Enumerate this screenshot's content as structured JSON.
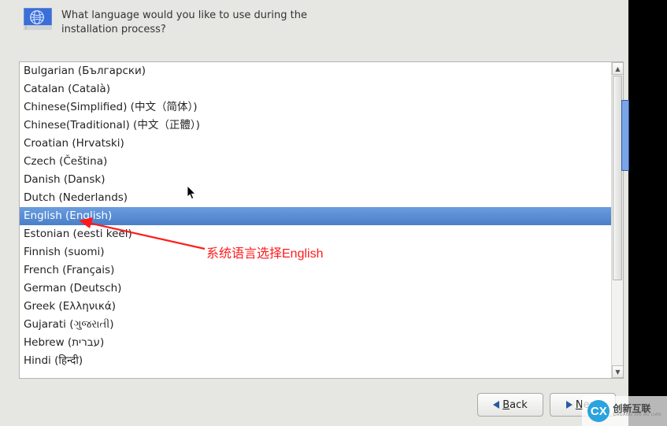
{
  "header": {
    "prompt_line1": "What language would you like to use during the",
    "prompt_line2": "installation process?"
  },
  "languages": [
    {
      "label": "Bulgarian (Български)",
      "selected": false
    },
    {
      "label": "Catalan (Català)",
      "selected": false
    },
    {
      "label": "Chinese(Simplified) (中文（简体）)",
      "selected": false
    },
    {
      "label": "Chinese(Traditional) (中文（正體）)",
      "selected": false
    },
    {
      "label": "Croatian (Hrvatski)",
      "selected": false
    },
    {
      "label": "Czech (Čeština)",
      "selected": false
    },
    {
      "label": "Danish (Dansk)",
      "selected": false
    },
    {
      "label": "Dutch (Nederlands)",
      "selected": false
    },
    {
      "label": "English (English)",
      "selected": true
    },
    {
      "label": "Estonian (eesti keel)",
      "selected": false
    },
    {
      "label": "Finnish (suomi)",
      "selected": false
    },
    {
      "label": "French (Français)",
      "selected": false
    },
    {
      "label": "German (Deutsch)",
      "selected": false
    },
    {
      "label": "Greek (Ελληνικά)",
      "selected": false
    },
    {
      "label": "Gujarati (ગુજરાતી)",
      "selected": false
    },
    {
      "label": "Hebrew (עברית)",
      "selected": false
    },
    {
      "label": "Hindi (हिन्दी)",
      "selected": false
    }
  ],
  "buttons": {
    "back_label": "Back",
    "back_accel": "B",
    "next_label": "Next",
    "next_accel": "N"
  },
  "annotation": {
    "text": "系统语言选择English"
  },
  "watermark": {
    "badge": "CX",
    "line1": "创新互联",
    "line2": "CHUANG XIN HU LIAN"
  }
}
